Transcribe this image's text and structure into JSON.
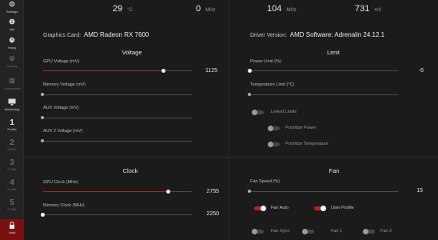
{
  "sidebar": {
    "settings": "Settings",
    "info": "Info",
    "hang": "Hang",
    "overlay": "Overlay",
    "commander": "Commander",
    "monitoring": "Monitoring",
    "profiles": [
      {
        "num": "1",
        "label": "Profile"
      },
      {
        "num": "2",
        "label": "Profile"
      },
      {
        "num": "3",
        "label": "Profile"
      },
      {
        "num": "4",
        "label": "Profile"
      },
      {
        "num": "5",
        "label": "Profile"
      }
    ],
    "lock": "Lock"
  },
  "readouts": {
    "temp": {
      "value": "29",
      "unit": "°C"
    },
    "clock": {
      "value": "0",
      "unit": "MHz"
    },
    "mem_clock": {
      "value": "104",
      "unit": "MHz"
    },
    "voltage": {
      "value": "731",
      "unit": "mV"
    }
  },
  "info": {
    "card_label": "Graphics Card:",
    "card_value": "AMD Radeon RX 7600",
    "driver_label": "Driver Version:",
    "driver_value": "AMD Software: Adrenalin 24.12.1"
  },
  "voltage": {
    "title": "Voltage",
    "sliders": [
      {
        "label": "GPU Voltage (mV)",
        "value": "1125",
        "level": 0.85
      },
      {
        "label": "Memory Voltage (mV)",
        "value": "",
        "level": 0
      },
      {
        "label": "AUX Voltage (mV)",
        "value": "",
        "level": 0
      },
      {
        "label": "AUX 2 Voltage (mV)",
        "value": "",
        "level": 0
      }
    ]
  },
  "limit": {
    "title": "Limit",
    "sliders": [
      {
        "label": "Power Limit (%)",
        "value": "-6",
        "level": 0
      },
      {
        "label": "Temperature Limit (°C)",
        "value": "",
        "level": 0
      }
    ],
    "linked_limits": "Linked Limits",
    "prioritize_power": "Prioritize Power",
    "prioritize_temperature": "Prioritize Temperature"
  },
  "clock": {
    "title": "Clock",
    "sliders": [
      {
        "label": "GPU Clock (MHz)",
        "value": "2755",
        "level": 0.88
      },
      {
        "label": "Memory Clock (MHz)",
        "value": "2250",
        "level": 0
      }
    ]
  },
  "fan": {
    "title": "Fan",
    "speed_label": "Fan Speed (%)",
    "speed_value": "15",
    "speed_level": 0,
    "fan_auto": "Fan Auto",
    "user_profile": "User Profile",
    "fan_sync": "Fan Sync",
    "fan1": "Fan 1",
    "fan2": "Fan 2"
  },
  "colors": {
    "accent": "#b62222",
    "active_side": "#7a1111",
    "background": "#1b1b1b"
  }
}
